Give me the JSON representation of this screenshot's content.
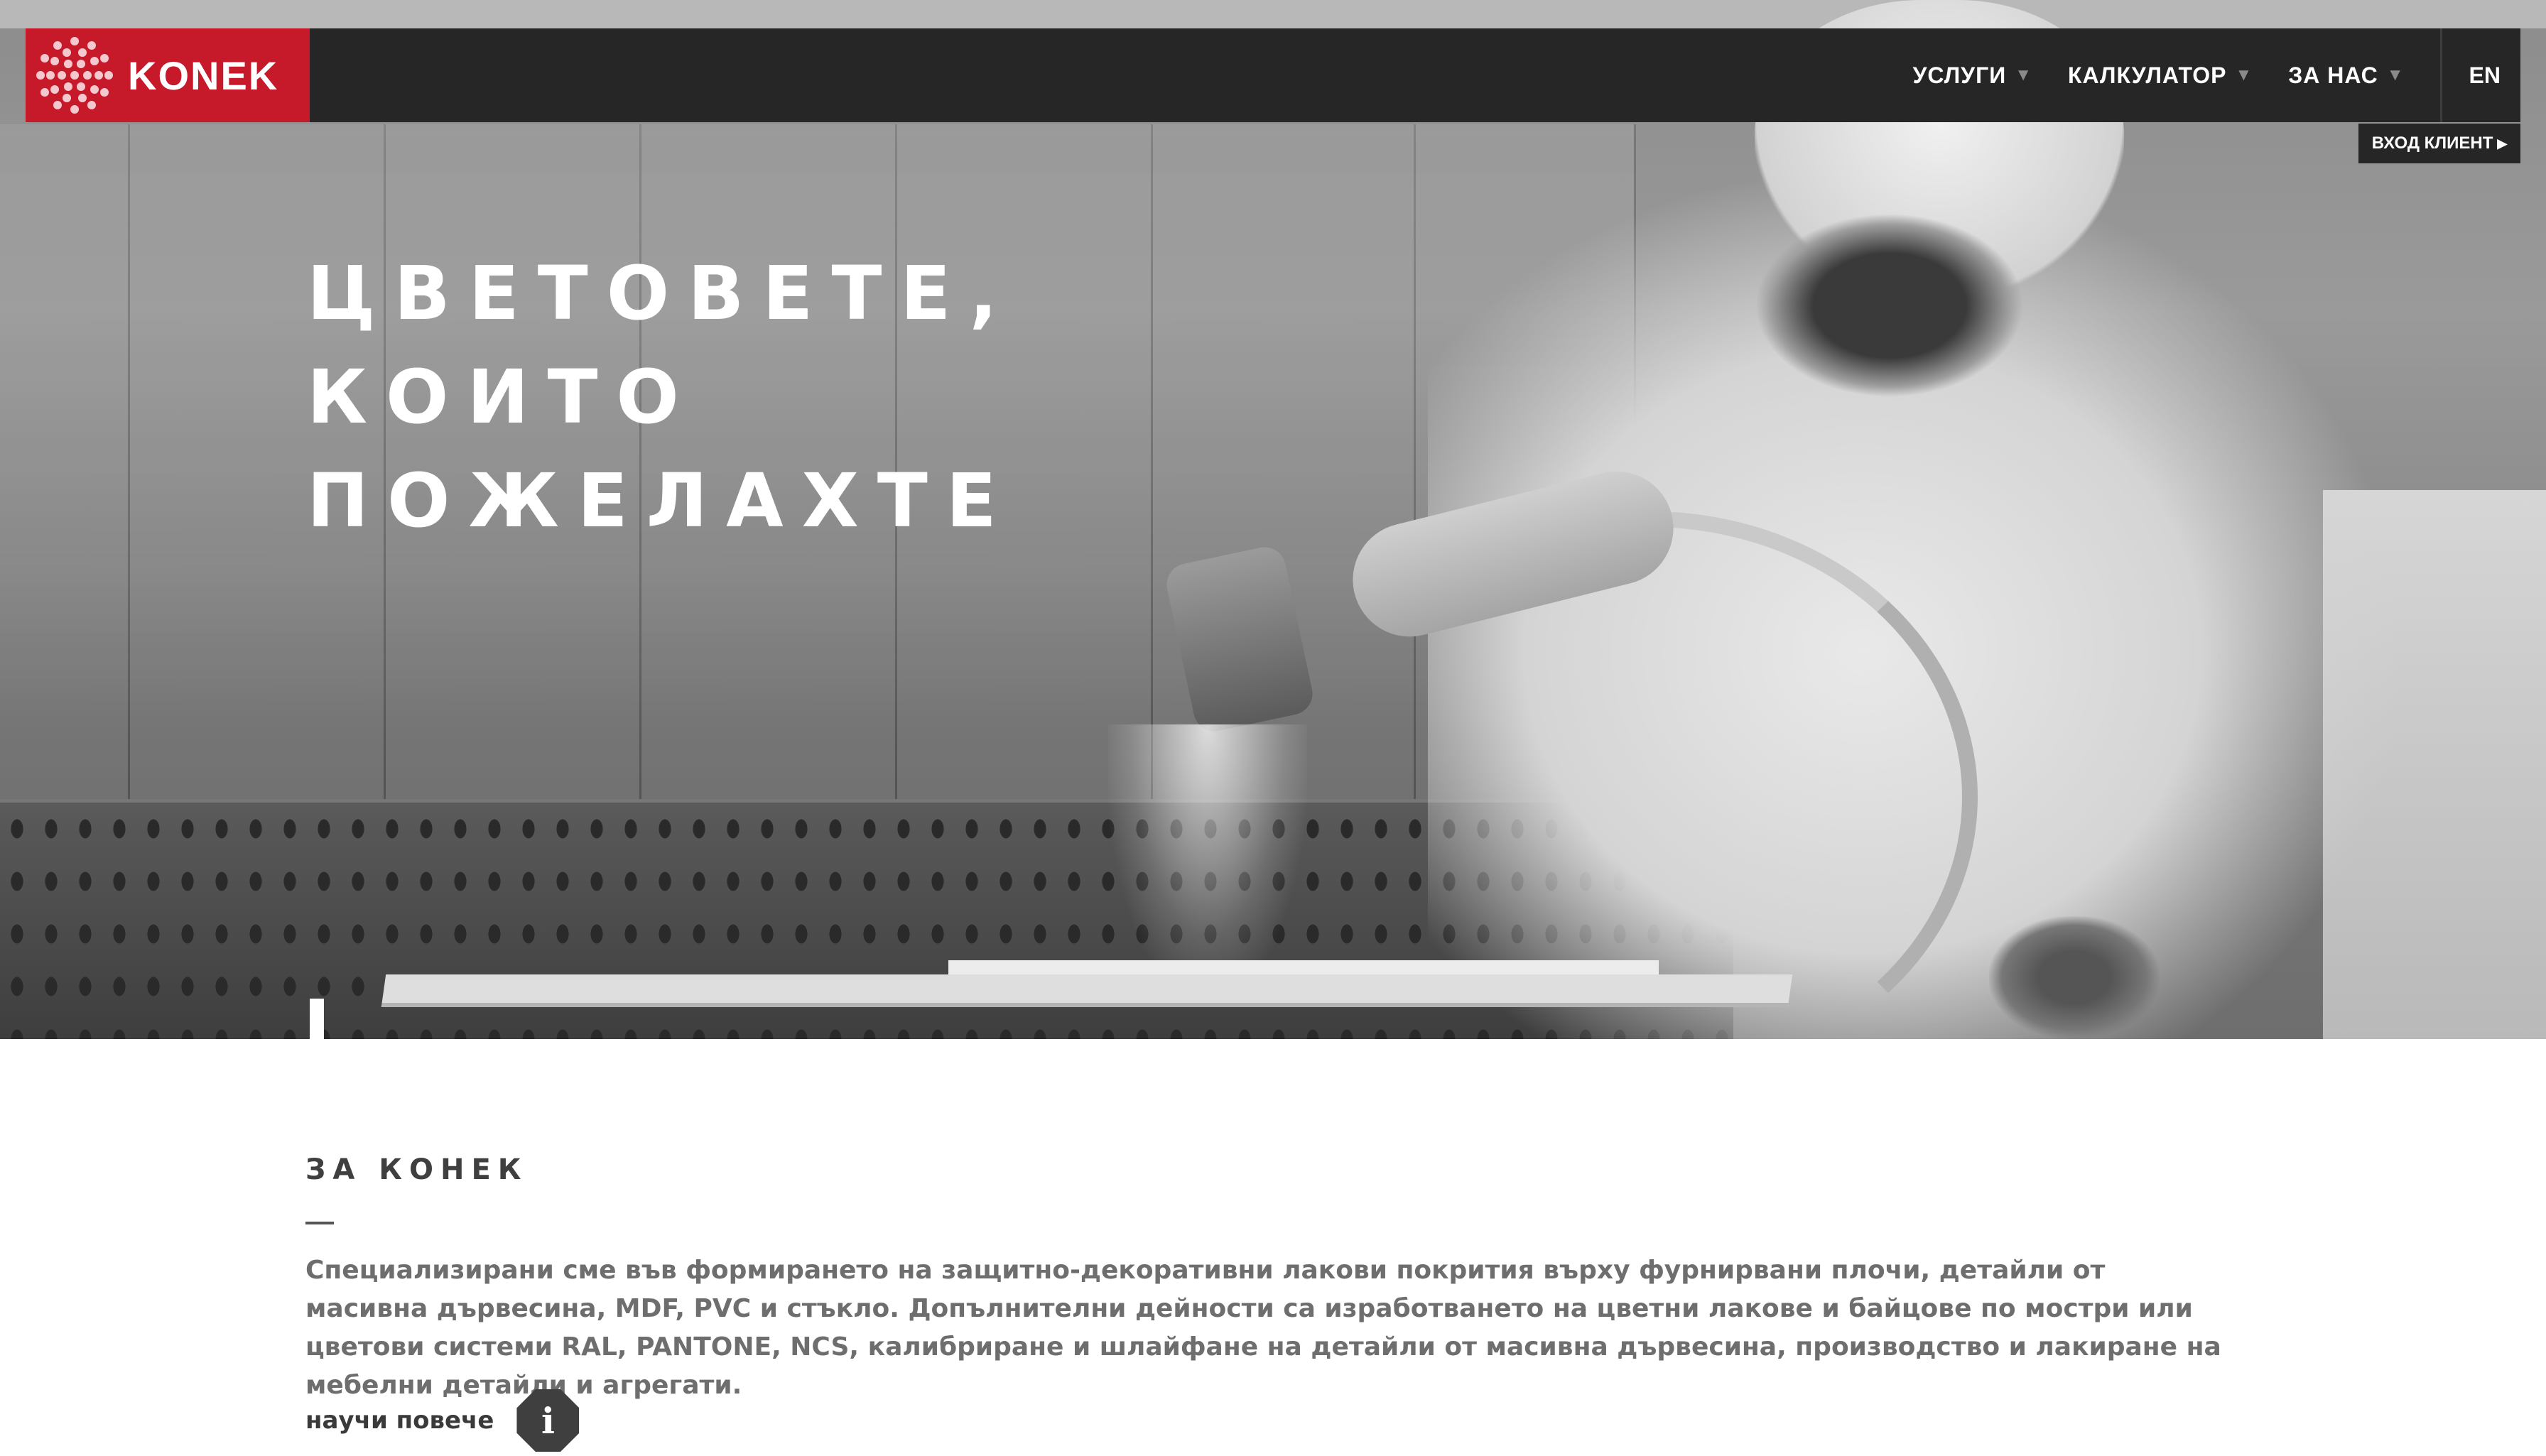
{
  "brand": {
    "name": "KONEK",
    "accent": "#c61a2b",
    "nav_bg": "#262626"
  },
  "nav": {
    "items": [
      {
        "label": "УСЛУГИ",
        "icon": "caret-down-icon"
      },
      {
        "label": "КАЛКУЛАТОР",
        "icon": "caret-down-icon"
      },
      {
        "label": "ЗА НАС",
        "icon": "caret-down-icon"
      }
    ],
    "lang": "EN",
    "client_login": "ВХОД КЛИЕНТ",
    "client_login_icon": "play-triangle-icon"
  },
  "hero": {
    "lines": [
      "ЦВЕТОВЕТЕ,",
      "КОИТО",
      "ПОЖЕЛАХТЕ"
    ]
  },
  "about": {
    "heading": "ЗА КОНЕК",
    "rule": "—",
    "text": "Специализирани сме във формирането на защитно-декоративни лакови покрития върху фурнирвани плочи, детайли от масивна дървесина, MDF, PVC и стъкло. Допълнителни дейности са изработването на цветни лакове и байцове по мостри или цветови системи RAL, PANTONE, NCS, калибриране и шлайфане на детайли от масивна дървесина, производство и лакиране на мебелни детайли и агрегати.",
    "learn_more": "научи повече",
    "info_icon": "info-icon",
    "info_glyph": "i"
  }
}
